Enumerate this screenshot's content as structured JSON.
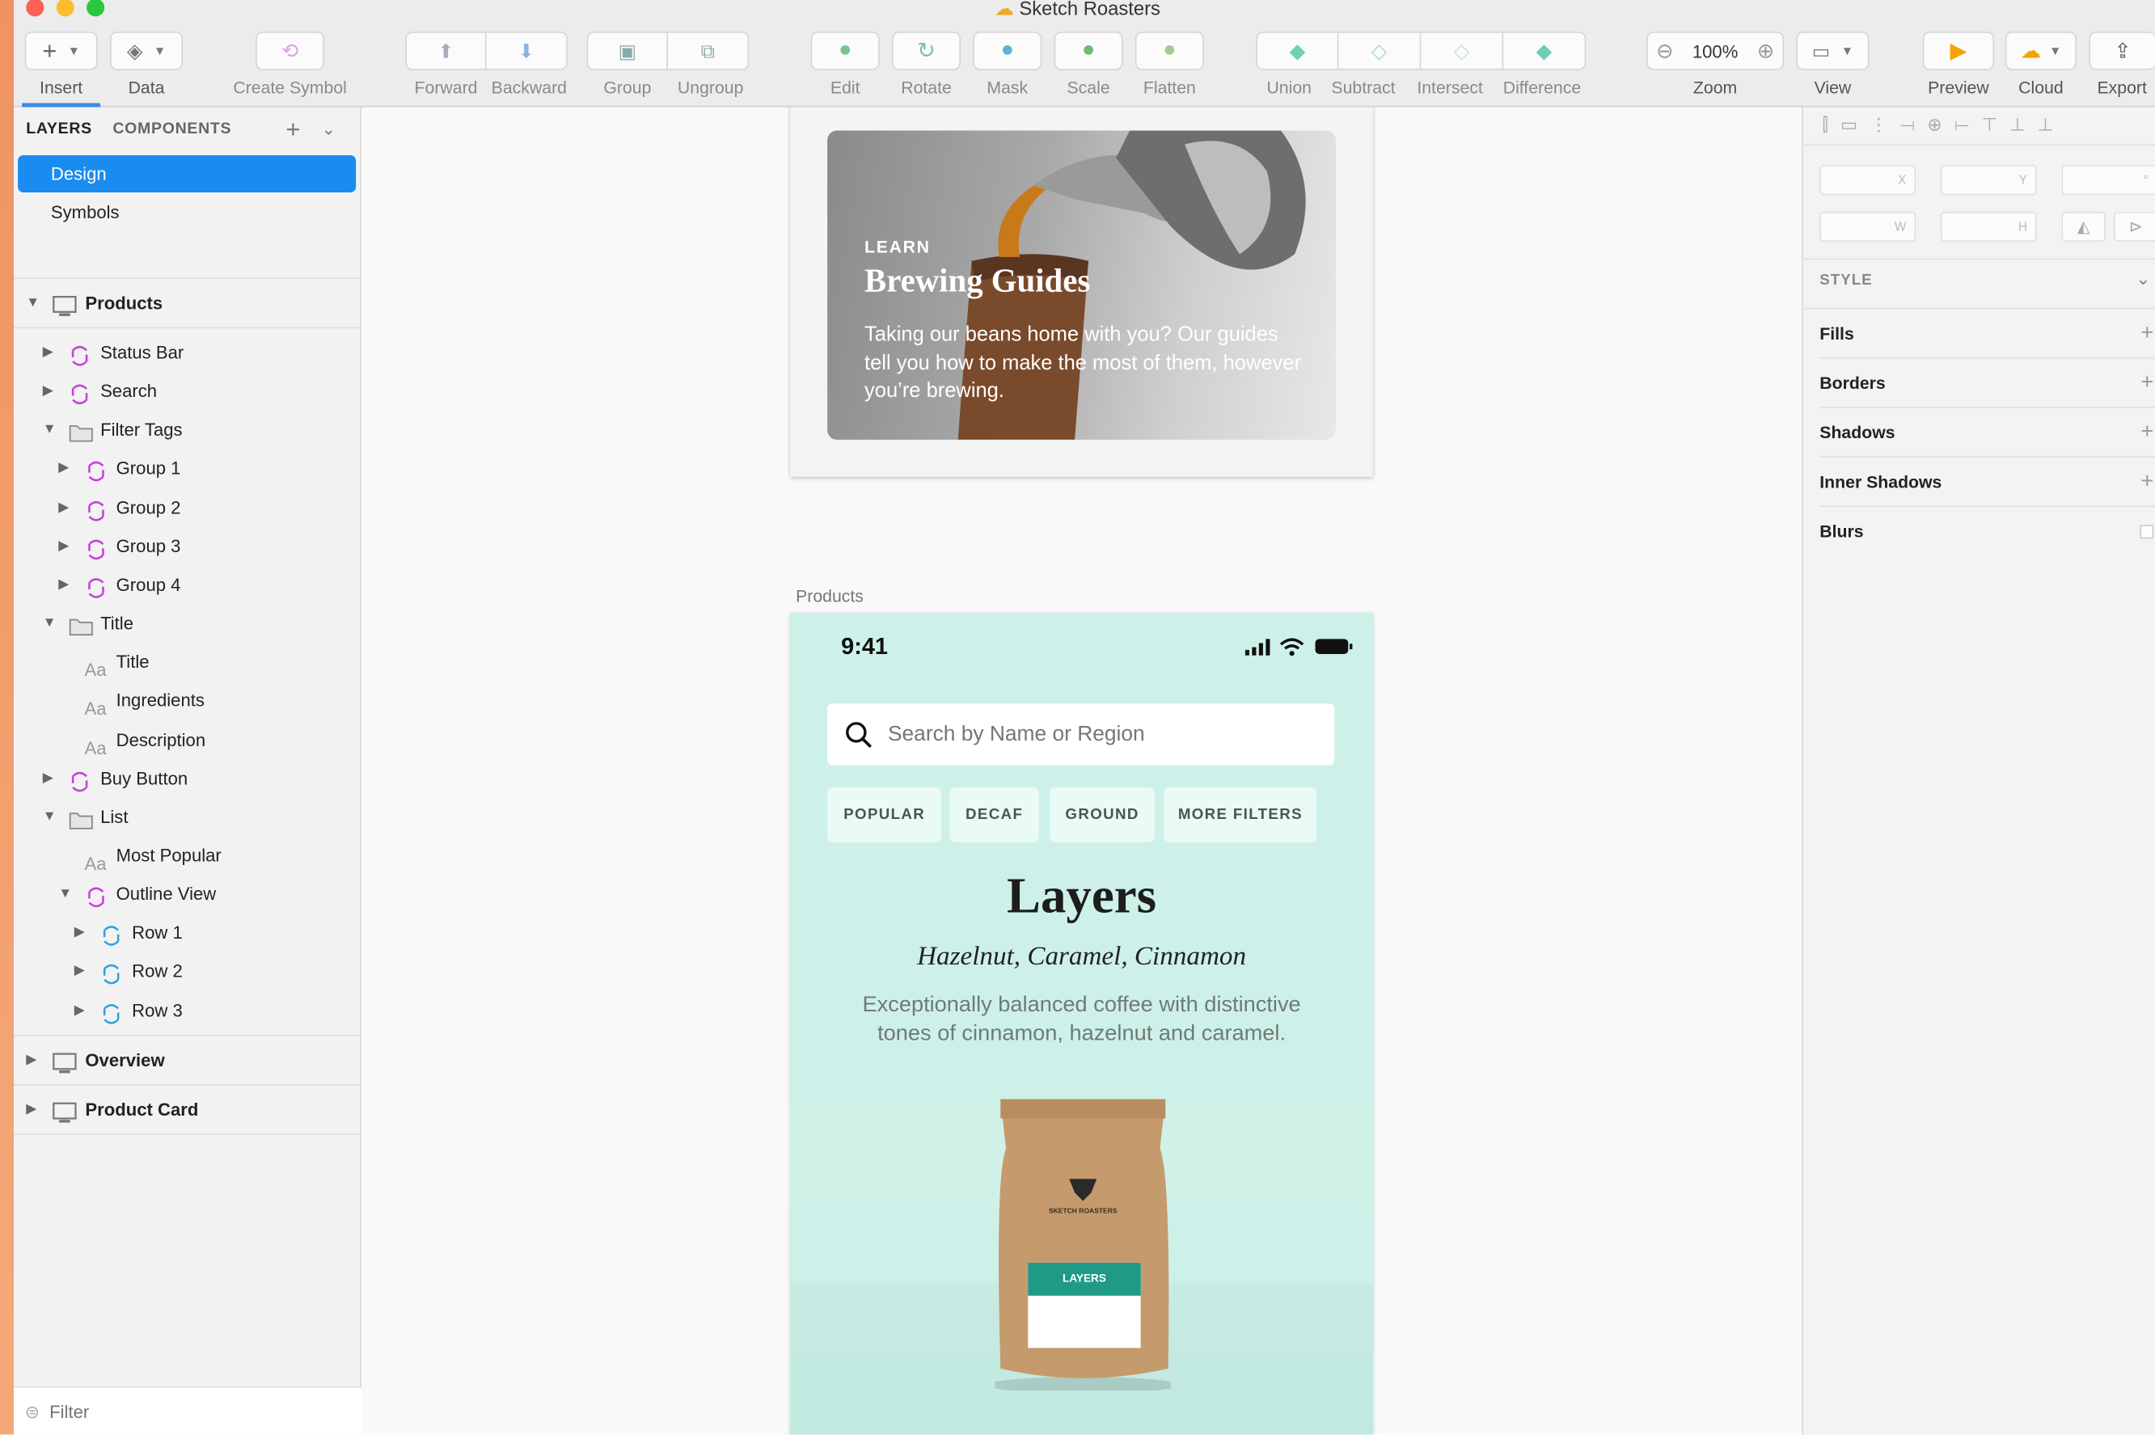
{
  "window": {
    "title": "Sketch Roasters"
  },
  "toolbar": {
    "insert": "Insert",
    "data": "Data",
    "create_symbol": "Create Symbol",
    "forward": "Forward",
    "backward": "Backward",
    "group": "Group",
    "ungroup": "Ungroup",
    "edit": "Edit",
    "rotate": "Rotate",
    "mask": "Mask",
    "scale": "Scale",
    "flatten": "Flatten",
    "union": "Union",
    "subtract": "Subtract",
    "intersect": "Intersect",
    "difference": "Difference",
    "zoom_value": "100%",
    "zoom": "Zoom",
    "view": "View",
    "preview": "Preview",
    "cloud": "Cloud",
    "export": "Export"
  },
  "left": {
    "tabs": [
      "LAYERS",
      "COMPONENTS"
    ],
    "pages": [
      "Design",
      "Symbols"
    ],
    "artboards": [
      "Products",
      "Overview",
      "Product Card"
    ],
    "layers": [
      "Status Bar",
      "Search",
      "Filter Tags",
      "Group 1",
      "Group 2",
      "Group 3",
      "Group 4",
      "Title",
      "Title",
      "Ingredients",
      "Description",
      "Buy Button",
      "List",
      "Most Popular",
      "Outline View",
      "Row 1",
      "Row 2",
      "Row 3"
    ],
    "filter_placeholder": "Filter"
  },
  "canvas": {
    "card": {
      "eyebrow": "LEARN",
      "title": "Brewing Guides",
      "body": "Taking our beans home with you? Our guides tell you how to make the most of them, however you’re brewing."
    },
    "artboard_label": "Products",
    "phone": {
      "time": "9:41",
      "search_placeholder": "Search by Name or Region",
      "filters": [
        "POPULAR",
        "DECAF",
        "GROUND",
        "MORE FILTERS"
      ],
      "product_name": "Layers",
      "ingredients": "Hazelnut, Caramel, Cinnamon",
      "description": "Exceptionally balanced coffee with distinctive tones of cinnamon, hazelnut and caramel.",
      "bag_brand": "SKETCH ROASTERS",
      "bag_label": "LAYERS"
    }
  },
  "inspector": {
    "fields": [
      "X",
      "Y",
      "W",
      "H"
    ],
    "style": "STYLE",
    "sections": [
      "Fills",
      "Borders",
      "Shadows",
      "Inner Shadows",
      "Blurs"
    ]
  },
  "colors": {
    "accent": "#1a8cf0",
    "symbol": "#c342d6",
    "phone_bg": "#cdf1e8",
    "bag_label": "#1f9a86"
  }
}
